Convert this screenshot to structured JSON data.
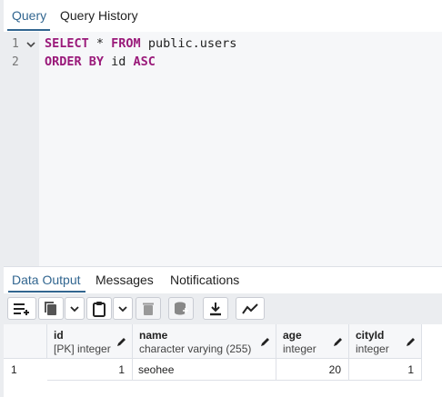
{
  "top_tabs": [
    "Query",
    "Query History"
  ],
  "editor": {
    "line_numbers": [
      "1",
      "2"
    ],
    "lines": [
      [
        {
          "t": "SELECT",
          "k": true
        },
        {
          "t": " * ",
          "k": false
        },
        {
          "t": "FROM",
          "k": true
        },
        {
          "t": " public.users",
          "k": false
        }
      ],
      [
        {
          "t": "ORDER BY",
          "k": true
        },
        {
          "t": " id ",
          "k": false
        },
        {
          "t": "ASC",
          "k": true
        }
      ]
    ]
  },
  "bottom_tabs": [
    "Data Output",
    "Messages",
    "Notifications"
  ],
  "toolbar": {
    "icons": [
      "add-row-icon",
      "copy-icon",
      "copy-dropdown-icon",
      "paste-icon",
      "paste-dropdown-icon",
      "delete-icon",
      "save-data-icon",
      "download-icon",
      "graph-visualiser-icon"
    ]
  },
  "grid": {
    "columns": [
      {
        "name": "id",
        "type": "[PK] integer"
      },
      {
        "name": "name",
        "type": "character varying (255)"
      },
      {
        "name": "age",
        "type": "integer"
      },
      {
        "name": "cityId",
        "type": "integer"
      }
    ],
    "rows": [
      {
        "row_no": "1",
        "cells": [
          "1",
          "seohee",
          "20",
          "1"
        ]
      }
    ]
  },
  "colors": {
    "accent": "#326690",
    "keyword": "#9a1a7a",
    "panel_bg": "#ebedf0",
    "editor_bg": "#f6f7f9"
  }
}
